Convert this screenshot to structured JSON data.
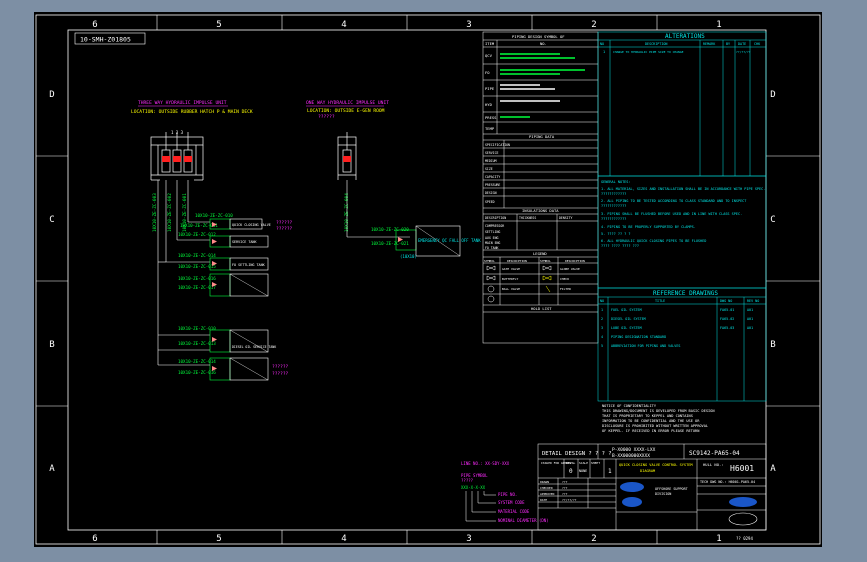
{
  "colors": {
    "page_bg": "#7d8fa4",
    "sheet_bg": "#000000",
    "frame": "#ffffff",
    "cyan": "#00e5e5",
    "green": "#00ff3c",
    "magenta": "#ff2bff",
    "yellow": "#ffff00",
    "red": "#ff2020",
    "pink": "#ff8a8a"
  },
  "border": {
    "columns": [
      "6",
      "5",
      "4",
      "3",
      "2",
      "1"
    ],
    "rows": [
      "D",
      "C",
      "B",
      "A"
    ]
  },
  "sheet_tag": "10-SMH-Z01805",
  "units": {
    "left_title": "THREE WAY HYDRAULIC IMPULSE UNIT",
    "left_location": "LOCATION: OUTSIDE RUBBER HATCH P & MAIN DECK",
    "right_title": "ONE WAY HYDRAULIC IMPULSE UNIT",
    "right_location": "LOCATION: OUTSIDE E-GEN ROOM",
    "right_location_sub": "??????"
  },
  "tags": {
    "vertical": [
      "10X10-ZE-ZC-003",
      "10X10-ZE-ZC-002",
      "10X10-ZE-ZC-001",
      "10X10-ZE-ZC-004"
    ],
    "box1": "10X10-ZE-ZC-010",
    "box1b": "10X10-ZE-ZC-011",
    "box2": "10X10-ZE-ZC-012",
    "box2b": "10X10-ZE-ZC-013",
    "box3": "10X10-ZE-ZC-014",
    "box3b": "10X10-ZE-ZC-015",
    "box4": "10X10-ZE-ZC-016",
    "box4b": "10X10-ZE-ZC-017",
    "emergency_line": "10X10-ZE-ZC-020",
    "emergency_line_b": "10X10-ZE-ZC-021",
    "emergency_box": "EMERGENCY QC FALL OFF TANK",
    "emergency_sub": "(10X10)",
    "box1_text": "QUICK CLOSING VALVE",
    "box2_text": "SERVICE TANK",
    "box3_text": "FO SETTLING TANK",
    "box4_text": "DIESEL OIL SERVICE TANK",
    "qmarks": "??????"
  },
  "piping_table": {
    "title": "PIPING DESIGN SYMBOL OF",
    "header_mark": "ITEM",
    "header_desc": "NO.",
    "rows": [
      "QCV",
      "FO",
      "PIPE",
      "HYD",
      "PRESS",
      "TEMP"
    ],
    "data_title": "PIPING DATA",
    "data_rows": [
      "SPECIFICATION",
      "SERVICE",
      "MEDIUM",
      "SIZE",
      "CAPACITY",
      "PRESSURE",
      "DESIGN",
      "SPEED"
    ],
    "insulation_title": "INSULATIONS DATA",
    "insulation_headers": [
      "DESCRIPTION",
      "THICKNESS",
      "DENSITY"
    ],
    "insulation_rows": [
      "COMPRESSOR",
      "SETTLING",
      "AUX ENG",
      "MAIN ENG",
      "FO TANK"
    ],
    "legend_title": "LEGEND",
    "legend_headers": [
      "SYMBOL",
      "DESCRIPTION",
      "SYMBOL",
      "DESCRIPTION"
    ],
    "legend_items": [
      "GATE VALVE",
      "BUTTERFLY",
      "BALL VALVE",
      "GLOBE VALVE",
      "CHECK",
      "FILTER"
    ],
    "hold_list": "HOLD LIST"
  },
  "alterations": {
    "title": "ALTERATIONS",
    "headers": [
      "NO",
      "DESCRIPTION",
      "REMARK",
      "BY",
      "DATE",
      "CHK"
    ],
    "rows": [
      [
        "1",
        "CHANGE TO HYDRAULIC PIPE SIZE TO CHANGE",
        "",
        "",
        "",
        "??/??/??"
      ]
    ]
  },
  "general_notes": {
    "title": "GENERAL NOTES:",
    "lines": [
      "1. ALL MATERIAL, SIZES AND INSTALLATION SHALL BE IN ACCORDANCE WITH PIPE SPEC.",
      "   ????????????",
      "2. ALL PIPING TO BE TESTED ACCORDING TO CLASS STANDARD AND TO INSPECT",
      "   ????????????",
      "3. PIPING SHALL BE FLUSHED BEFORE USED AND IN LINE WITH CLASS SPEC.",
      "   ????????????",
      "4. PIPING TO BE PROPERLY SUPPORTED BY CLAMPS.",
      "5. ???? ?? ? ?",
      "6. ALL HYDRAULIC QUICK CLOSING PIPES TO BE FLUSHED",
      "   ???? ???? ???? ???"
    ]
  },
  "reference": {
    "title": "REFERENCE DRAWINGS",
    "headers": [
      "NO",
      "TITLE",
      "DWG NO",
      "REV NO"
    ],
    "rows": [
      [
        "1",
        "FUEL OIL SYSTEM",
        "FA65-01",
        "A01"
      ],
      [
        "2",
        "DIESEL OIL SYSTEM",
        "FA65-02",
        "A01"
      ],
      [
        "3",
        "LUBE OIL SYSTEM",
        "FA65-03",
        "A01"
      ],
      [
        "4",
        "PIPING DESIGNATION STANDARD",
        "",
        ""
      ],
      [
        "5",
        "ABBREVIATION FOR PIPING AND VALVES",
        "",
        ""
      ]
    ]
  },
  "confidential": {
    "lines": [
      "NOTICE OF CONFIDENTIALITY",
      "THIS DRAWING/DOCUMENT IS DEVELOPED FROM BASIC DESIGN",
      "THAT IS PROPRIETARY TO KEPPEL AND CONTAINS",
      "INFORMATION TO BE CONFIDENTIAL AND THE USE OR",
      "DISCLOSURE IS PROHIBITED WITHOUT WRITTEN APPROVAL",
      "OF KEPPEL. IF RECEIVED IN ERROR PLEASE RETURN"
    ]
  },
  "pipe_key": {
    "line_no": "LINE NO.: XX-SDY-XXX",
    "pipe_symbol": "PIPE SYMBOL",
    "code": "?????",
    "sample": "XXX-X-X-XX",
    "labels": [
      "PIPE NO.",
      "SYSTEM CODE",
      "MATERIAL CODE",
      "NOMINAL DIAMETER (DN)"
    ]
  },
  "title_block": {
    "detail_design": "DETAIL DESIGN ? ? ? ?",
    "p_block": "P-X0000 XXXX-LXX",
    "b_block": "B-XX000000XXXX",
    "drawing_number": "SC9142-PA65-04",
    "hull_label": "HULL NO.:",
    "hull_no": "H6001",
    "doc_no": "TECH DWG NO.: H6001-PA65-04",
    "title": "QUICK CLOSING VALVE CONTROL SYSTEM",
    "title_sub": "DIAGRAM",
    "status_label": "ISSUED FOR APPROVAL",
    "rev_label": "REV",
    "rev": "0",
    "scale_label": "SCALE",
    "scale": "NONE",
    "sheet_label": "SHEET",
    "sheet": "1",
    "client": "OFFSHORE SUPPORT",
    "client2": "DIVISION",
    "roles": [
      "DRAWN",
      "CHECKED",
      "APPROVED",
      "DATE"
    ],
    "role_values": [
      "???",
      "???",
      "???",
      "??/??/??"
    ],
    "bottom_ref": "?? 0294"
  }
}
